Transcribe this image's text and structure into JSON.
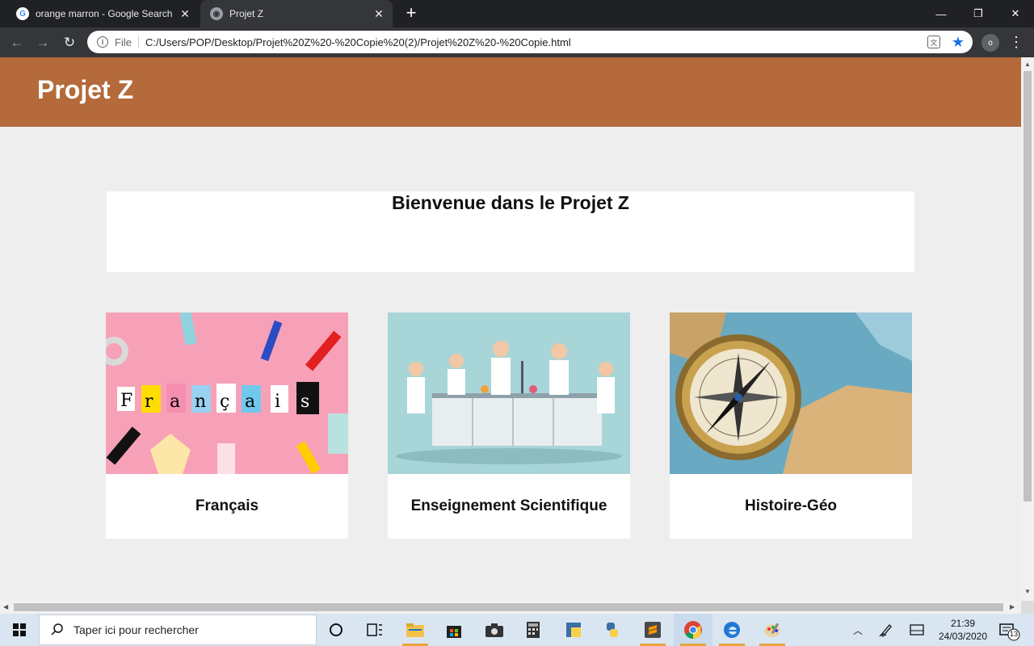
{
  "browser": {
    "tabs": [
      {
        "title": "orange marron - Google Search",
        "active": false
      },
      {
        "title": "Projet Z",
        "active": true
      }
    ],
    "url_scheme": "File",
    "url": "C:/Users/POP/Desktop/Projet%20Z%20-%20Copie%20(2)/Projet%20Z%20-%20Copie.html",
    "profile_initial": "o"
  },
  "page": {
    "site_title": "Projet Z",
    "welcome_heading": "Bienvenue dans le Projet Z",
    "cards": [
      {
        "label": "Français",
        "image": "francais-letters-image"
      },
      {
        "label": "Enseignement Scientifique",
        "image": "scientists-lab-image"
      },
      {
        "label": "Histoire-Géo",
        "image": "compass-map-image"
      }
    ],
    "colors": {
      "header": "#b46a3a",
      "background": "#eeeeee"
    }
  },
  "taskbar": {
    "search_placeholder": "Taper ici pour rechercher",
    "time": "21:39",
    "date": "24/03/2020",
    "notification_count": "13"
  }
}
